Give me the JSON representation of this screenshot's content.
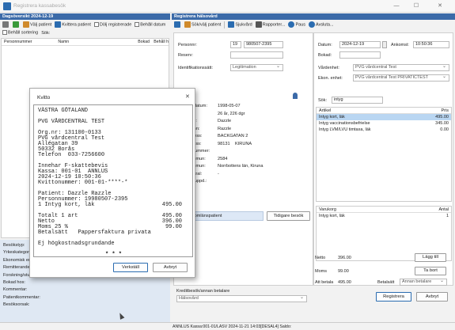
{
  "window": {
    "title": "Registrera kassabesök",
    "minimize": "—",
    "maximize": "☐",
    "close": "✕"
  },
  "left_header": "Dagsöversikt 2024-12-19",
  "left_toolbar": {
    "select_patient": "Välj patient",
    "pay_receipt": "Kvittera patient",
    "hide_registered": "Dölj registrerade",
    "keep_date": "Behåll datum",
    "keep_sort": "Behåll sortering",
    "search_label": "Sök:"
  },
  "left_columns": [
    "Personnummer",
    "Namn",
    "Bokad",
    "Behåll h"
  ],
  "left_bottom_labels": [
    "Besökstyp:",
    "Yrkeskategori:",
    "Ekonomisk enhet:",
    "Remitterande:",
    "Forskning/studie:",
    "Bokad hos:",
    "Kommentar:",
    "Patientkommentar:",
    "Besöksorsak:"
  ],
  "right_header": "Registrera hälsovård",
  "right_toolbar": {
    "search_patient": "Sök/välj patient",
    "sickleave": "Sjukvård",
    "reports": "Rapporter...",
    "pause": "Paus",
    "quit": "Avsluta..."
  },
  "patient": {
    "pnr_label": "Personnr:",
    "pnr_century": "19",
    "pnr_value": "980507-2395",
    "reserve_label": "Reserv:",
    "id_label": "Identifikationssätt:",
    "id_value": "Legitimation",
    "birth_label": "Födelsedatum:",
    "birth_value": "1998-05-07",
    "age_label": "Ålder:",
    "age_value": "26 år, 226 dgr",
    "first_label": "Förnamn:",
    "first_value": "Dazzle",
    "last_label": "Efternamn:",
    "last_value": "Razzle",
    "street_label": "Gatuadress:",
    "street_value": "BACKGATAN 2",
    "post_label": "Postadress:",
    "post_code": "98131",
    "post_city": "KIRUNA",
    "phone_label": "Telefonnummer:",
    "county_label": "Län Kommun:",
    "county_value": "2584",
    "county2_label": "Län Kommun:",
    "county2_value": "Norrbottens län, Kiruna",
    "vc_label": "Vårdcentral:",
    "vc_value": "-",
    "listing_label": "Listning uppd.:",
    "foreign_badge": "Utomlänspatient",
    "prev_visits": "Tidigare besök"
  },
  "visit": {
    "date_label": "Datum:",
    "date_value": "2024-12-19",
    "arrival_label": "Ankomst:",
    "arrival_value": "10:50:36",
    "booked_label": "Bokad:",
    "unit_label": "Vårdenhet:",
    "unit_value": "PVG vårdcentral Test",
    "econ_label": "Ekon. enhet:",
    "econ_value": "PVG vårdcentral Test PRIVATICTEST"
  },
  "article_search": {
    "label": "Sök:",
    "value": "intyg"
  },
  "articles": {
    "head_article": "Artikel",
    "head_price": "Pris",
    "rows": [
      {
        "name": "Intyg kort, läk",
        "price": "495.00",
        "hl": true
      },
      {
        "name": "Intyg vaccinationsbefrielse",
        "price": "345.00",
        "hl": false
      },
      {
        "name": "Intyg LVM/LVU timtaxa, läk",
        "price": "0.00",
        "hl": false
      }
    ]
  },
  "cart": {
    "head_item": "Varukorg",
    "head_qty": "Antal",
    "rows": [
      {
        "name": "Intyg kort, läk",
        "qty": "1"
      }
    ]
  },
  "totals": {
    "net_label": "Netto",
    "net_value": "396.00",
    "vat_label": "Moms",
    "vat_value": "99.00",
    "pay_label": "Att betala",
    "pay_value": "495.00",
    "payer_label": "Betalsätt",
    "payer_value": "Annan betalare",
    "add_btn": "Lägg till",
    "remove_btn": "Ta bort",
    "register_btn": "Registrera",
    "cancel_btn": "Avbryt"
  },
  "credit": {
    "label": "Kreditbesök/annan betalare",
    "value": "Hälsovård"
  },
  "status_bar": "ANNLUS Kassa:001-01/LASV 2024-11-21 14:03[DESAL4] Saldo:",
  "receipt_dialog": {
    "title": "Kvitto",
    "close": "✕",
    "lines": [
      "VÄSTRA GÖTALAND",
      "",
      "PVG VÅRDCENTRAL TEST",
      "",
      "Org.nr: 131100-0133",
      "PVG vårdcentral Test",
      "Allégatan 39",
      "50332 Borås",
      "Telefon  033-7256600",
      "",
      "Innehar F-skattebevis",
      "Kassa: 001-01  ANNLUS",
      "2024-12-19 10:50:36",
      "Kvittonummer: 001-01-****-*",
      "",
      "Patient: Dazzle Razzle",
      "Personnummer: 19980507-2395"
    ],
    "item_line": "1 Intyg kort, läk",
    "item_price": "495.00",
    "totals": [
      {
        "label": "Totalt 1 art",
        "value": "495.00"
      },
      {
        "label": "Netto",
        "value": "396.00"
      },
      {
        "label": "Moms 25 %",
        "value": "99.00"
      }
    ],
    "pay_line": "Betalsätt   Pappersfaktura privata",
    "note": "Ej högkostnadsgrundande",
    "dots": "* * *",
    "print_btn": "Verkställ",
    "cancel_btn": "Avbryt"
  }
}
